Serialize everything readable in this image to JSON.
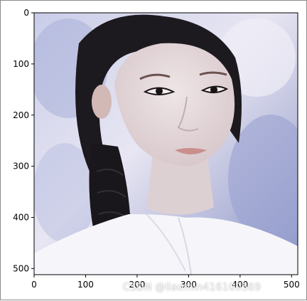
{
  "chart_data": {
    "type": "image",
    "title": "",
    "xlabel": "",
    "ylabel": "",
    "xlim": [
      0,
      512
    ],
    "ylim": [
      512,
      0
    ],
    "xticks": [
      0,
      100,
      200,
      300,
      400,
      500
    ],
    "yticks": [
      0,
      100,
      200,
      300,
      400,
      500
    ],
    "grid": false,
    "image_content": "portrait of a young woman with dark braided hair and a white robe against a pale blue-lilac painted background"
  },
  "watermark": {
    "text": "CSDN @liaomin416100569"
  },
  "colors": {
    "background_light": "#e4e4f2",
    "background_blue": "#8892c4",
    "hair": "#1c1a1e",
    "skin": "#e6d9da",
    "robe": "#f6f6fa",
    "lips": "#c98f8d"
  }
}
